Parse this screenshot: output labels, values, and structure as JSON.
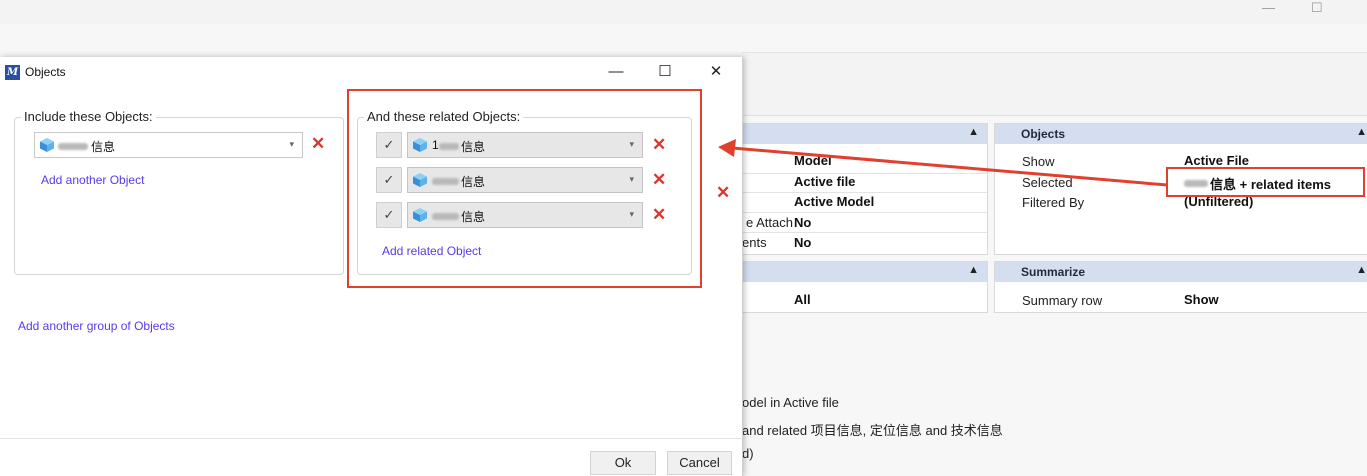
{
  "dialog": {
    "title": "Objects",
    "minimize_glyph": "—",
    "maximize_glyph": "☐",
    "close_glyph": "✕",
    "include_group_title": "Include these Objects:",
    "include_object": {
      "suffix": "信息",
      "icon": "object-cube-icon"
    },
    "add_another_object": "Add another Object",
    "related_group_title": "And these related Objects:",
    "related_objects": [
      {
        "check": "✓",
        "prefix": "1",
        "suffix": "信息",
        "icon": "object-cube-icon"
      },
      {
        "check": "✓",
        "prefix": "",
        "suffix": "信息",
        "icon": "object-cube-icon"
      },
      {
        "check": "✓",
        "prefix": "",
        "suffix": "信息",
        "icon": "object-cube-icon"
      }
    ],
    "add_related_object": "Add related Object",
    "add_another_group": "Add another group of Objects",
    "delete_glyph": "✕",
    "dropdown_glyph": "▾",
    "ok_label": "Ok",
    "cancel_label": "Cancel"
  },
  "background": {
    "window_minimize": "—",
    "window_maximize": "☐",
    "left_panel": {
      "collapse": "▲",
      "rows": [
        {
          "key": "",
          "value": "Model"
        },
        {
          "key": "",
          "value": "Active file"
        },
        {
          "key": "",
          "value": "Active Model"
        },
        {
          "key": "e Attach",
          "value": "No"
        },
        {
          "key": "ents",
          "value": "No"
        }
      ]
    },
    "objects_panel": {
      "title": "Objects",
      "collapse": "▲",
      "rows": [
        {
          "key": "Show",
          "value": "Active File"
        },
        {
          "key": "Selected",
          "value": "信息 + related items"
        },
        {
          "key": "Filtered By",
          "value": "(Unfiltered)"
        }
      ]
    },
    "left_panel_2": {
      "collapse": "▲",
      "value": "All"
    },
    "summarize_panel": {
      "title": "Summarize",
      "collapse": "▲",
      "row": {
        "key": "Summary row",
        "value": "Show"
      }
    },
    "summary_lines": [
      "odel  in Active file",
      "and related 项目信息, 定位信息 and 技术信息",
      "d)"
    ]
  },
  "colors": {
    "accent_red": "#d9372e",
    "link_purple": "#5b39e8",
    "panel_header": "#d4deee",
    "highlight_red": "#e0412f"
  }
}
